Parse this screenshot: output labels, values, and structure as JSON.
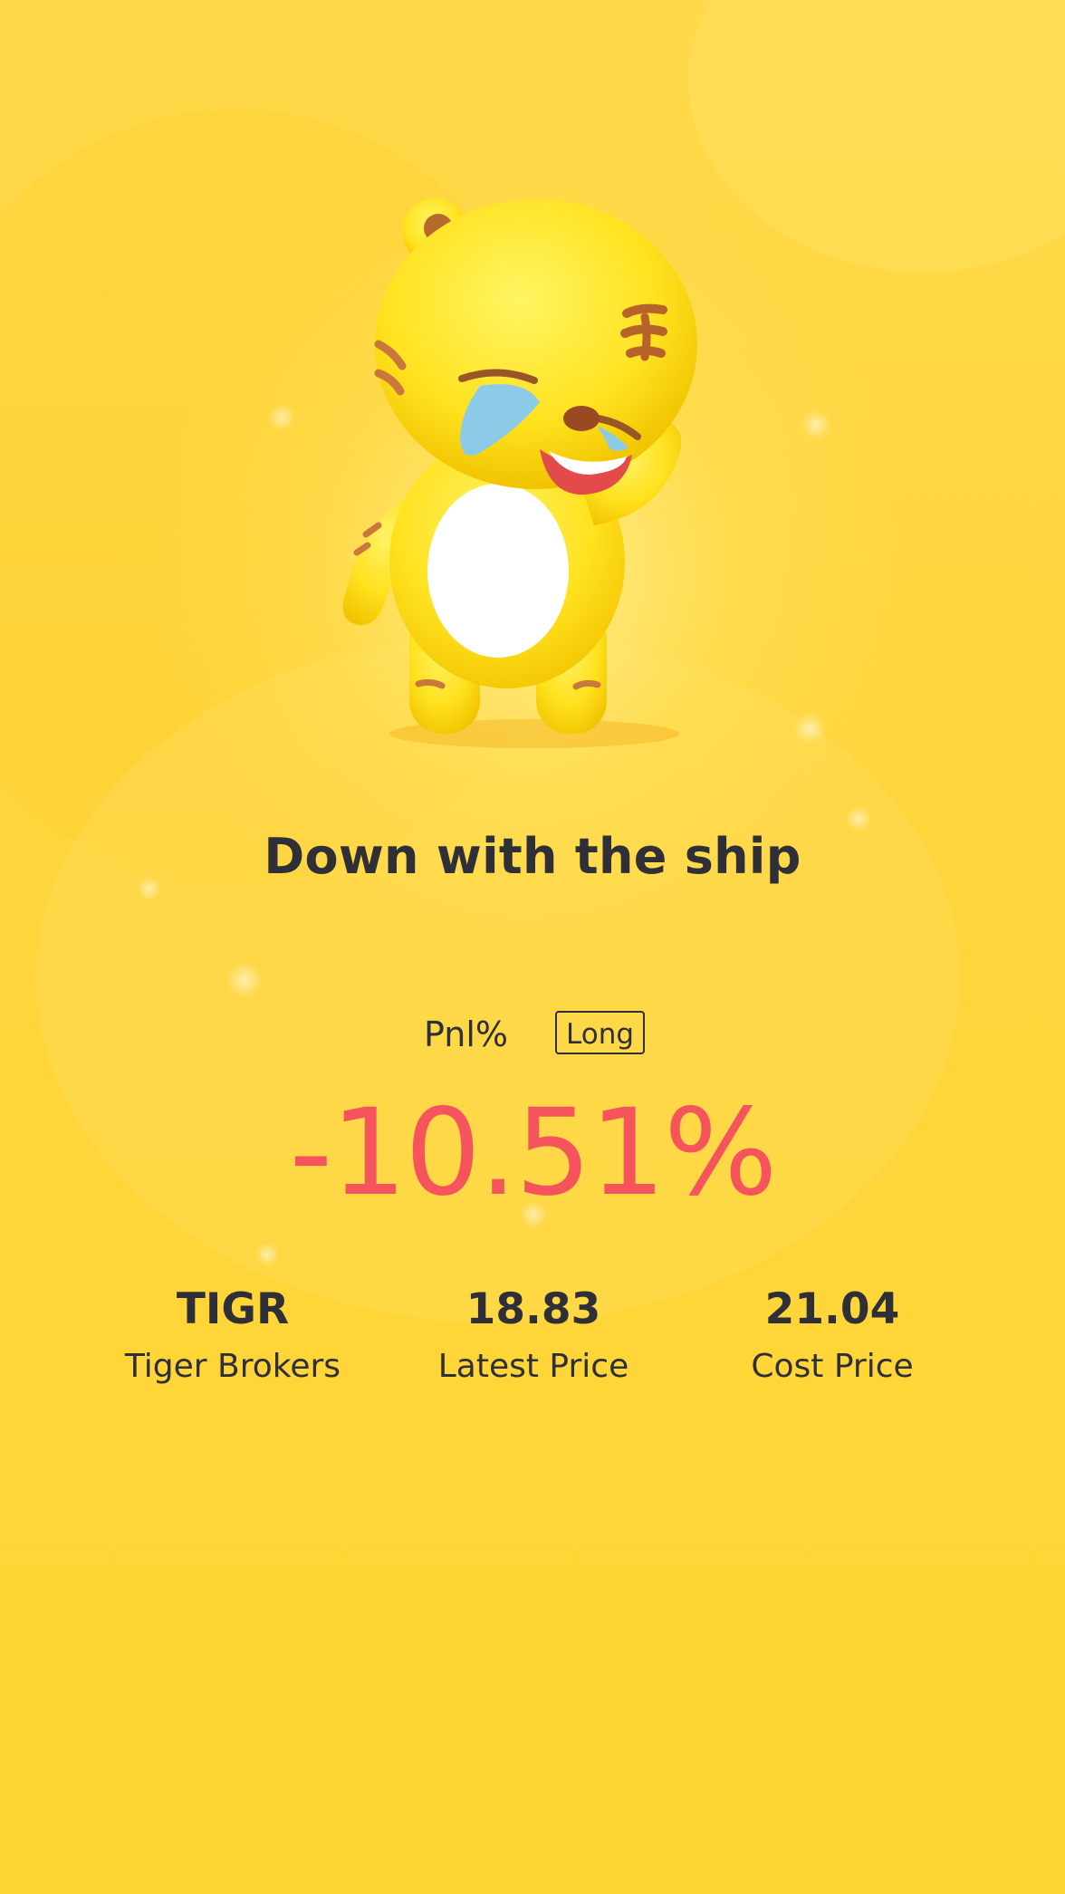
{
  "headline": "Down with the ship",
  "pnl": {
    "label": "Pnl%",
    "direction": "Long",
    "value": "-10.51%"
  },
  "stats": [
    {
      "value": "TIGR",
      "label": "Tiger Brokers"
    },
    {
      "value": "18.83",
      "label": "Latest Price"
    },
    {
      "value": "21.04",
      "label": "Cost Price"
    }
  ],
  "mascot": {
    "icon": "crying-tiger-mascot"
  },
  "colors": {
    "background": "#ffd63c",
    "text": "#2f2f37",
    "loss": "#f5545c"
  }
}
